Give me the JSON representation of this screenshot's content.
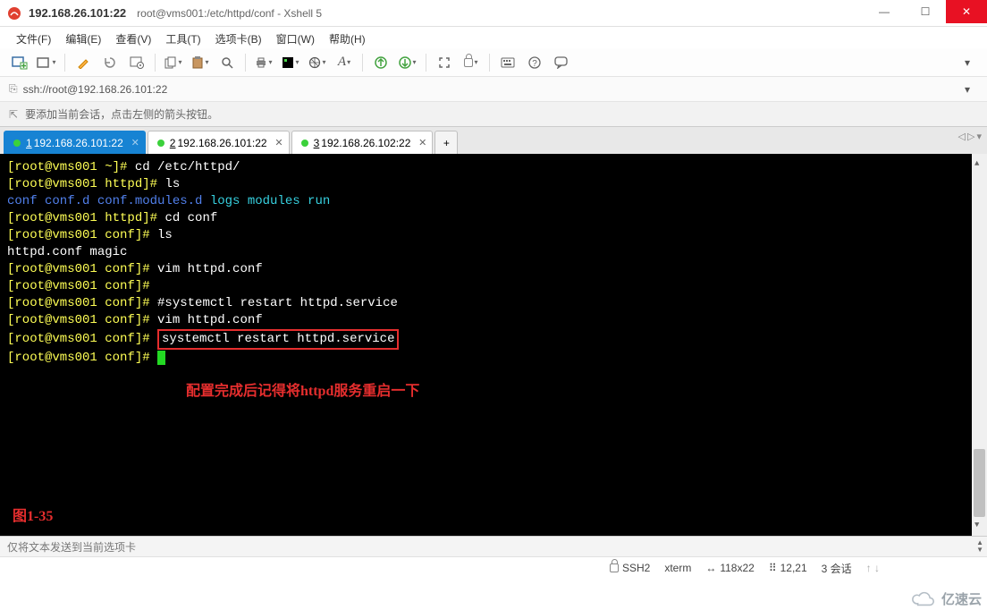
{
  "window": {
    "ip_title": "192.168.26.101:22",
    "sub_title": "root@vms001:/etc/httpd/conf - Xshell 5"
  },
  "menu": {
    "file": "文件(F)",
    "edit": "编辑(E)",
    "view": "查看(V)",
    "tools": "工具(T)",
    "tabs": "选项卡(B)",
    "window": "窗口(W)",
    "help": "帮助(H)"
  },
  "address": {
    "url": "ssh://root@192.168.26.101:22"
  },
  "hint": {
    "text": "要添加当前会话，点击左侧的箭头按钮。"
  },
  "tabs": [
    {
      "num": "1",
      "label": "192.168.26.101:22",
      "active": true
    },
    {
      "num": "2",
      "label": "192.168.26.101:22",
      "active": false
    },
    {
      "num": "3",
      "label": "192.168.26.102:22",
      "active": false
    }
  ],
  "term": {
    "l1_prompt_pre": "[root@vms001 ~]# ",
    "l1_cmd": "cd /etc/httpd/",
    "l2_prompt_pre": "[root@vms001 httpd]# ",
    "l2_cmd": "ls",
    "l3_a": "conf  conf.d  conf.modules.d",
    "l3_b": "  logs  modules  run",
    "l4_prompt_pre": "[root@vms001 httpd]# ",
    "l4_cmd": "cd conf",
    "l5_prompt_pre": "[root@vms001 conf]# ",
    "l5_cmd": "ls",
    "l6": "httpd.conf  magic",
    "l7_prompt_pre": "[root@vms001 conf]# ",
    "l7_cmd": "vim httpd.conf",
    "l8_prompt_pre": "[root@vms001 conf]# ",
    "l9_prompt_pre": "[root@vms001 conf]# ",
    "l9_cmd": "#systemctl restart httpd.service",
    "l10_prompt_pre": "[root@vms001 conf]# ",
    "l10_cmd": "vim httpd.conf",
    "l11_prompt_pre": "[root@vms001 conf]# ",
    "l11_cmd": "systemctl restart httpd.service",
    "l12_prompt_pre": "[root@vms001 conf]# ",
    "annotation": "配置完成后记得将httpd服务重启一下",
    "figure_label": "图1-35"
  },
  "status_input": {
    "text": "仅将文本发送到当前选项卡"
  },
  "status": {
    "protocol": "SSH2",
    "term_type": "xterm",
    "size": "118x22",
    "cursor": "12,21",
    "sessions": "3 会话"
  },
  "watermark": {
    "text": "亿速云"
  }
}
